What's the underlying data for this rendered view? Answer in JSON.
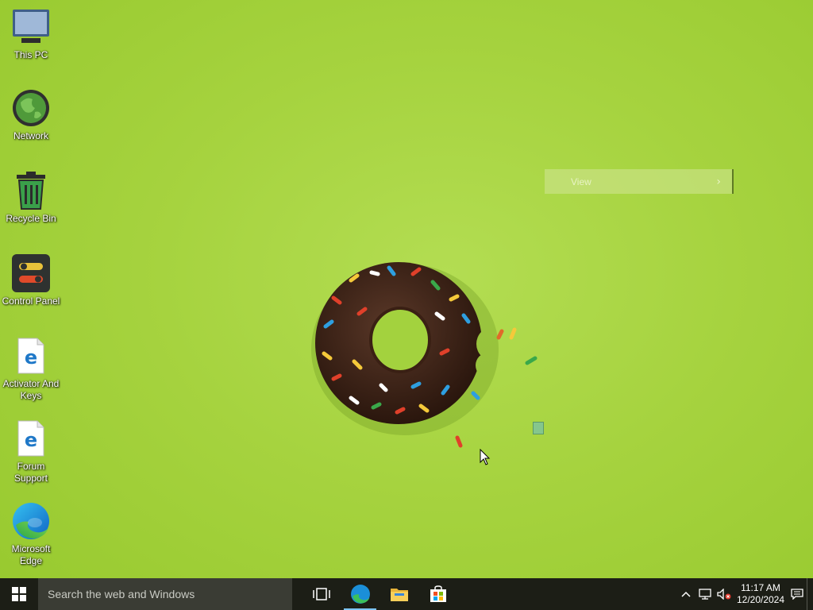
{
  "desktop": {
    "icons": [
      {
        "label": "This PC",
        "icon": "monitor-icon"
      },
      {
        "label": "Network",
        "icon": "globe-icon"
      },
      {
        "label": "Recycle Bin",
        "icon": "recycle-bin-icon"
      },
      {
        "label": "Control Panel",
        "icon": "control-panel-icon"
      },
      {
        "label": "Activator And Keys",
        "icon": "edge-document-icon"
      },
      {
        "label": "Forum Support",
        "icon": "edge-document-icon"
      },
      {
        "label": "Microsoft Edge",
        "icon": "edge-icon"
      }
    ],
    "view_menu": {
      "label": "View",
      "arrow": "›"
    },
    "wallpaper": "green background with a bitten chocolate sprinkle donut"
  },
  "taskbar": {
    "search_placeholder": "Search the web and Windows",
    "pinned": [
      {
        "name": "task-view",
        "icon": "task-view-icon"
      },
      {
        "name": "microsoft-edge",
        "icon": "edge-icon",
        "active": true
      },
      {
        "name": "file-explorer",
        "icon": "folder-icon"
      },
      {
        "name": "microsoft-store",
        "icon": "store-icon"
      }
    ],
    "tray": {
      "chevron": "^",
      "icons": [
        "network-icon",
        "volume-muted-icon",
        "notification-icon"
      ]
    },
    "clock": {
      "time": "11:17 AM",
      "date": "12/20/2024"
    }
  },
  "colors": {
    "taskbar": "#1c1e16",
    "search": "#3a3c34",
    "accent": "#7cc4f4",
    "wallpaper": "#a6d33f"
  }
}
